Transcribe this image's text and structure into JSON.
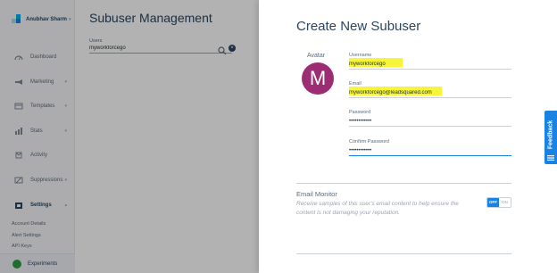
{
  "sidebar": {
    "account_name": "Anubhav Sharm",
    "items": [
      {
        "label": "Dashboard",
        "icon": "dashboard-icon",
        "has_chevron": false
      },
      {
        "label": "Marketing",
        "icon": "megaphone-icon",
        "has_chevron": true
      },
      {
        "label": "Templates",
        "icon": "templates-icon",
        "has_chevron": true
      },
      {
        "label": "Stats",
        "icon": "stats-icon",
        "has_chevron": true
      },
      {
        "label": "Activity",
        "icon": "activity-icon",
        "has_chevron": false
      },
      {
        "label": "Suppressions",
        "icon": "suppressions-icon",
        "has_chevron": true
      },
      {
        "label": "Settings",
        "icon": "settings-icon",
        "has_chevron": true
      }
    ],
    "settings_subitems": [
      "Account Details",
      "Alert Settings",
      "API Keys"
    ],
    "experiments_label": "Experiments"
  },
  "main": {
    "title": "Subuser Management",
    "users_label": "Users",
    "users_value": "myworkforcego"
  },
  "panel": {
    "title": "Create New Subuser",
    "avatar_label": "Avatar",
    "avatar_letter": "M",
    "avatar_color": "#9c2d74",
    "username_label": "Username",
    "username_value": "myworkforcego",
    "email_label": "Email",
    "email_value": "myworkforcego@leadsquared.com",
    "password_label": "Password",
    "password_value": "••••••••••••",
    "confirm_label": "Confirm Password",
    "confirm_value": "••••••••••••",
    "email_monitor_title": "Email Monitor",
    "email_monitor_desc": "Receive samples of this user's email content to help ensure the content is not damaging your reputation.",
    "toggle_off": "OFF",
    "toggle_on": "ON",
    "toggle_state": "off"
  },
  "feedback_label": "Feedback",
  "colors": {
    "accent": "#1a82e2",
    "highlight": "#f7f53a",
    "heading": "#294661"
  }
}
